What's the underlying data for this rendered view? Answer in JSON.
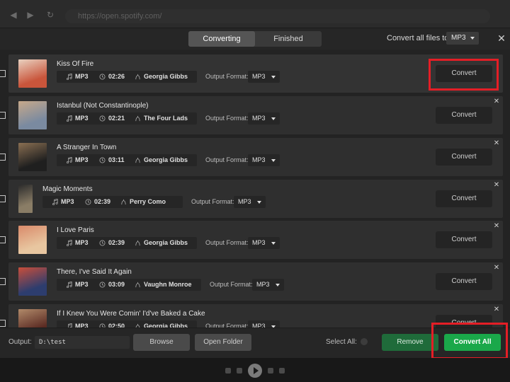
{
  "browser": {
    "url": "https://open.spotify.com/"
  },
  "header": {
    "tabs": [
      {
        "label": "Converting"
      },
      {
        "label": "Finished"
      }
    ],
    "convert_all_label": "Convert all files to:",
    "format": "MP3"
  },
  "labels": {
    "output_format": "Output Format:",
    "convert": "Convert"
  },
  "rows": [
    {
      "title": "Kiss Of Fire",
      "format": "MP3",
      "duration": "02:26",
      "artist": "Georgia Gibbs",
      "output_format": "MP3"
    },
    {
      "title": "Istanbul (Not Constantinople)",
      "format": "MP3",
      "duration": "02:21",
      "artist": "The Four Lads",
      "output_format": "MP3"
    },
    {
      "title": "A Stranger In Town",
      "format": "MP3",
      "duration": "03:11",
      "artist": "Georgia Gibbs",
      "output_format": "MP3"
    },
    {
      "title": "Magic Moments",
      "format": "MP3",
      "duration": "02:39",
      "artist": "Perry Como",
      "output_format": "MP3"
    },
    {
      "title": "I Love Paris",
      "format": "MP3",
      "duration": "02:39",
      "artist": "Georgia Gibbs",
      "output_format": "MP3"
    },
    {
      "title": "There, I've Said It Again",
      "format": "MP3",
      "duration": "03:09",
      "artist": "Vaughn Monroe",
      "output_format": "MP3"
    },
    {
      "title": "If I Knew You Were Comin' I'd've Baked a Cake",
      "format": "MP3",
      "duration": "02:50",
      "artist": "Georgia Gibbs",
      "output_format": "MP3"
    }
  ],
  "footer": {
    "output_label": "Output:",
    "output_path": "D:\\test",
    "browse": "Browse",
    "open_folder": "Open Folder",
    "select_all": "Select All:",
    "remove": "Remove",
    "convert_all": "Convert All"
  },
  "colors": {
    "accent_green": "#1aa84a",
    "remove_green": "#1f6b3a",
    "highlight_red": "#e41e26"
  }
}
